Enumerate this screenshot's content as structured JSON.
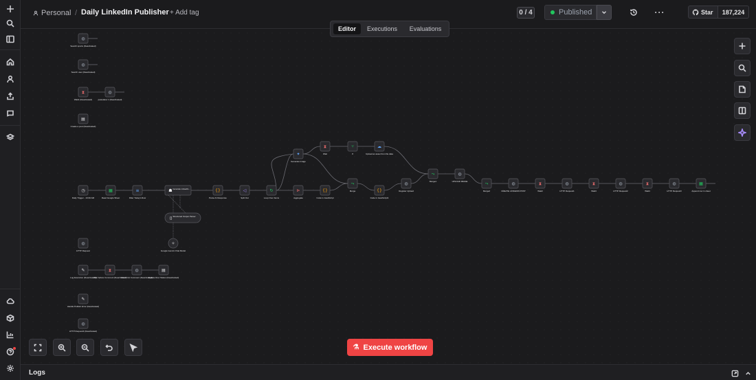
{
  "header": {
    "project": "Personal",
    "separator": "/",
    "workflow_title": "Daily LinkedIn Publisher",
    "add_tag": "+ Add tag",
    "version_counter": "0 / 4",
    "status": "Published",
    "star_label": "Star",
    "star_count": "187,224"
  },
  "tabs": [
    "Editor",
    "Executions",
    "Evaluations"
  ],
  "execute_button": "Execute workflow",
  "logs_label": "Logs",
  "colors": {
    "accent": "#ef4444",
    "published_dot": "#22c55e",
    "canvas_bg": "#1b1b1d",
    "node_bg": "#2a2a2e"
  },
  "nodes": [
    {
      "id": "n1",
      "label": "Search sports (Deactivated)",
      "icon": "globe-icon"
    },
    {
      "id": "n2",
      "label": "Search user (Deactivated)",
      "icon": "globe-icon"
    },
    {
      "id": "n3",
      "label": "Wait1 (Deactivated)",
      "icon": "hourglass-icon"
    },
    {
      "id": "n4",
      "label": "postolatov 1 (Deactivated)",
      "icon": "globe-icon"
    },
    {
      "id": "n5",
      "label": "Create a post (Deactivated)",
      "icon": "doc-icon"
    },
    {
      "id": "n6",
      "label": "Daily Trigger - 10:00 AM",
      "icon": "clock-icon"
    },
    {
      "id": "n7",
      "label": "Read Google Sheet",
      "icon": "sheet-icon"
    },
    {
      "id": "n8",
      "label": "Filter Today's Row",
      "icon": "filter-icon"
    },
    {
      "id": "n9",
      "label": "Generate LinkedIn...",
      "icon": "agent-icon"
    },
    {
      "id": "n10",
      "label": "Parse AI Response",
      "icon": "code-icon"
    },
    {
      "id": "n11",
      "label": "Split Out",
      "icon": "split-icon"
    },
    {
      "id": "n12",
      "label": "Loop Over Items",
      "icon": "loop-icon"
    },
    {
      "id": "n13",
      "label": "Generate Image",
      "icon": "sparkle-icon"
    },
    {
      "id": "n14",
      "label": "Wait",
      "icon": "hourglass-icon"
    },
    {
      "id": "n15",
      "label": "If",
      "icon": "branch-icon"
    },
    {
      "id": "n16",
      "label": "Upload an asset from file data",
      "icon": "cloud-icon"
    },
    {
      "id": "n17",
      "label": "Aggregate",
      "icon": "aggregate-icon"
    },
    {
      "id": "n18",
      "label": "Code in JavaScript",
      "icon": "code-icon"
    },
    {
      "id": "n19",
      "label": "Merge",
      "icon": "merge-icon"
    },
    {
      "id": "n20",
      "label": "Code in JavaScript1",
      "icon": "code-icon"
    },
    {
      "id": "n21",
      "label": "Register Upload",
      "icon": "globe-icon"
    },
    {
      "id": "n22",
      "label": "Merge1",
      "icon": "merge-icon"
    },
    {
      "id": "n23",
      "label": "UPLOAD IMAGE",
      "icon": "globe-icon"
    },
    {
      "id": "n24",
      "label": "Merge2",
      "icon": "merge-icon"
    },
    {
      "id": "n25",
      "label": "CREATE LINKEDIN POST",
      "icon": "globe-icon"
    },
    {
      "id": "n26",
      "label": "Wait2",
      "icon": "hourglass-icon"
    },
    {
      "id": "n27",
      "label": "HTTP Request1",
      "icon": "globe-icon"
    },
    {
      "id": "n28",
      "label": "Wait3",
      "icon": "hourglass-icon"
    },
    {
      "id": "n29",
      "label": "HTTP Request2",
      "icon": "globe-icon"
    },
    {
      "id": "n30",
      "label": "Wait4",
      "icon": "hourglass-icon"
    },
    {
      "id": "n31",
      "label": "HTTP Request3",
      "icon": "globe-icon"
    },
    {
      "id": "n32",
      "label": "Append row in sheet",
      "icon": "sheet-icon"
    },
    {
      "id": "n33",
      "label": "Structured Output Parser",
      "icon": "parser-icon"
    },
    {
      "id": "n34",
      "label": "Google Gemini Chat Model",
      "icon": "gemini-icon"
    },
    {
      "id": "n35",
      "label": "HTTP Request",
      "icon": "globe-icon"
    },
    {
      "id": "n36",
      "label": "Log Execution (Deactivated)",
      "icon": "edit-icon"
    },
    {
      "id": "n37",
      "label": "Wait before Comment (Deactivated)",
      "icon": "hourglass-icon"
    },
    {
      "id": "n38",
      "label": "Post First Comment (Deactivated)",
      "icon": "globe-icon"
    },
    {
      "id": "n39",
      "label": "Update Row Status (Deactivated)",
      "icon": "doc-icon"
    },
    {
      "id": "n40",
      "label": "Handle Publish Error (Deactivated)",
      "icon": "edit-icon"
    },
    {
      "id": "n41",
      "label": "HTTP Request4 (Deactivated)",
      "icon": "globe-icon"
    }
  ]
}
